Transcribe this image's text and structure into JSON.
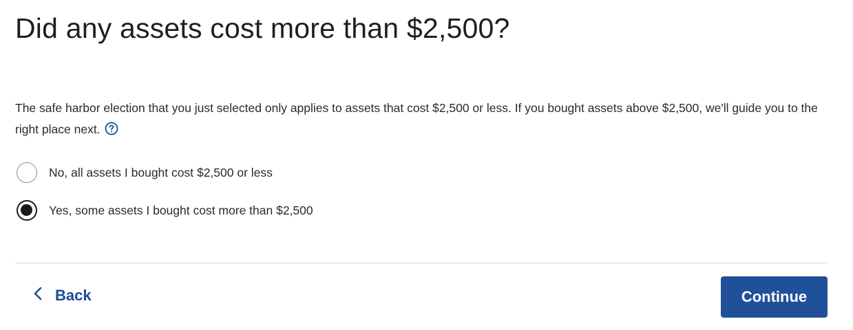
{
  "header": {
    "title": "Did any assets cost more than $2,500?"
  },
  "main": {
    "description": "The safe harbor election that you just selected only applies to assets that cost $2,500 or less. If you bought assets above $2,500, we'll guide you to the right place next.",
    "help_icon": "question-circle-icon",
    "options": [
      {
        "label": "No, all assets I bought cost $2,500 or less",
        "selected": false
      },
      {
        "label": "Yes, some assets I bought cost more than $2,500",
        "selected": true
      }
    ]
  },
  "footer": {
    "back_label": "Back",
    "back_icon": "chevron-left-icon",
    "continue_label": "Continue"
  },
  "colors": {
    "primary_button": "#1f5099",
    "link": "#1d4c94",
    "divider": "#d6d9dd",
    "text": "#1f1f1f"
  }
}
